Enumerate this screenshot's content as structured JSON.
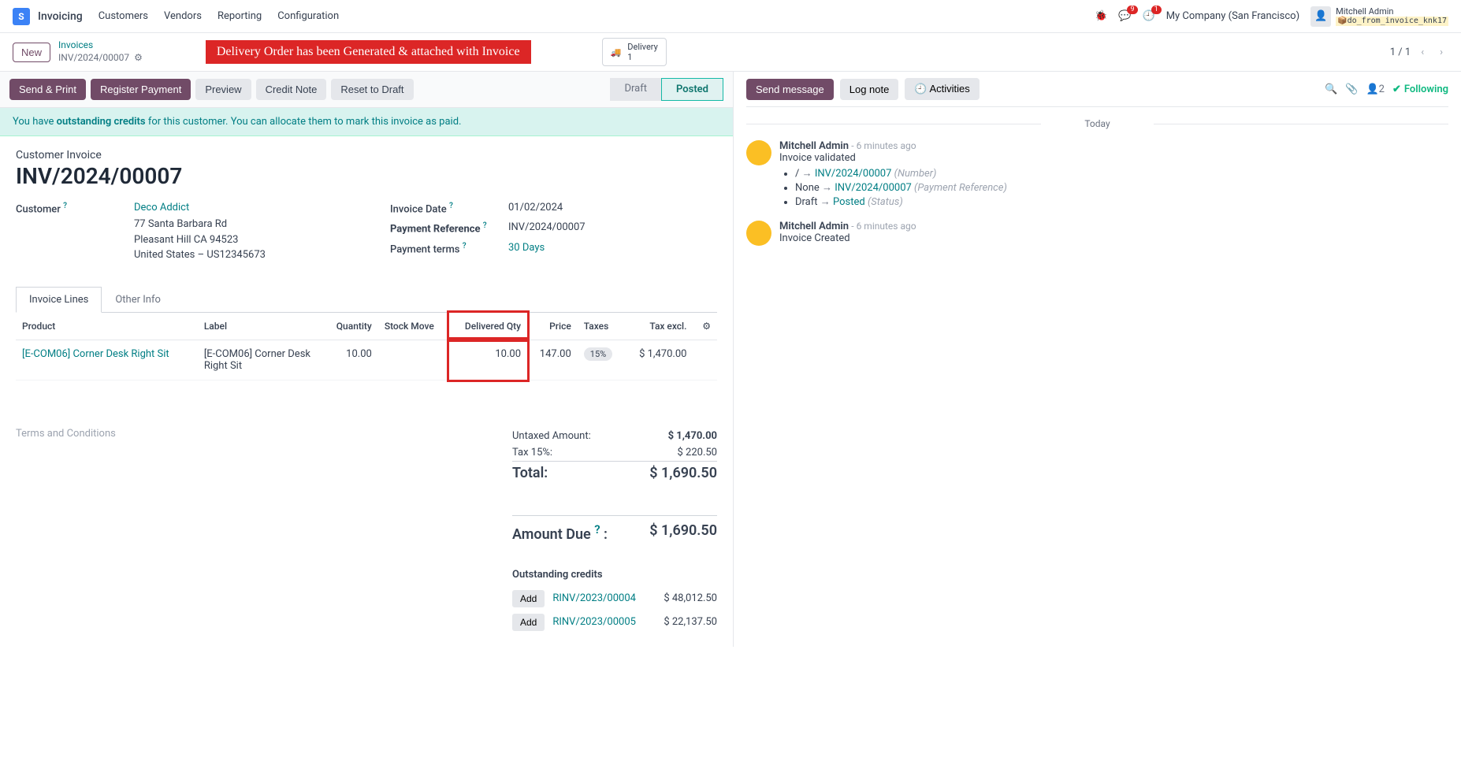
{
  "nav": {
    "app": "Invoicing",
    "menus": [
      "Customers",
      "Vendors",
      "Reporting",
      "Configuration"
    ],
    "company": "My Company (San Francisco)",
    "user": "Mitchell Admin",
    "db": "do_from_invoice_knk17",
    "msg_badge": "9",
    "activity_badge": "1"
  },
  "breadcrumb": {
    "new": "New",
    "parent": "Invoices",
    "current": "INV/2024/00007"
  },
  "annotation": "Delivery Order has been Generated & attached with Invoice",
  "smartbutton": {
    "label": "Delivery",
    "count": "1"
  },
  "pager": "1 / 1",
  "buttons": {
    "send": "Send & Print",
    "register": "Register Payment",
    "preview": "Preview",
    "credit": "Credit Note",
    "reset": "Reset to Draft"
  },
  "statuses": {
    "draft": "Draft",
    "posted": "Posted"
  },
  "alert": {
    "pre": "You have ",
    "bold": "outstanding credits",
    "post": " for this customer. You can allocate them to mark this invoice as paid."
  },
  "doc": {
    "type": "Customer Invoice",
    "name": "INV/2024/00007",
    "customer_label": "Customer",
    "customer": "Deco Addict",
    "addr1": "77 Santa Barbara Rd",
    "addr2": "Pleasant Hill CA 94523",
    "addr3": "United States – US12345673",
    "invdate_label": "Invoice Date",
    "invdate": "01/02/2024",
    "payref_label": "Payment Reference",
    "payref": "INV/2024/00007",
    "terms_label": "Payment terms",
    "terms": "30 Days"
  },
  "tabs": {
    "lines": "Invoice Lines",
    "other": "Other Info"
  },
  "columns": {
    "product": "Product",
    "label": "Label",
    "qty": "Quantity",
    "stock": "Stock Move",
    "delivered": "Delivered Qty",
    "price": "Price",
    "taxes": "Taxes",
    "taxexcl": "Tax excl."
  },
  "line": {
    "product": "[E-COM06] Corner Desk Right Sit",
    "label": "[E-COM06] Corner Desk Right Sit",
    "qty": "10.00",
    "stock": "",
    "delivered": "10.00",
    "price": "147.00",
    "tax": "15%",
    "taxexcl": "$ 1,470.00"
  },
  "termsplaceholder": "Terms and Conditions",
  "totals": {
    "untaxed_l": "Untaxed Amount:",
    "untaxed_v": "$ 1,470.00",
    "tax_l": "Tax 15%:",
    "tax_v": "$ 220.50",
    "total_l": "Total:",
    "total_v": "$ 1,690.50",
    "due_l": "Amount Due",
    "due_v": "$ 1,690.50"
  },
  "outstanding": {
    "title": "Outstanding credits",
    "add": "Add",
    "rows": [
      {
        "ref": "RINV/2023/00004",
        "amt": "$ 48,012.50"
      },
      {
        "ref": "RINV/2023/00005",
        "amt": "$ 22,137.50"
      }
    ]
  },
  "chatter": {
    "send": "Send message",
    "log": "Log note",
    "activities": "Activities",
    "followcount": "2",
    "following": "Following",
    "today": "Today",
    "msg1": {
      "author": "Mitchell Admin",
      "time": "- 6 minutes ago",
      "title": "Invoice validated",
      "li1_a": "/",
      "li1_b": "INV/2024/00007",
      "li1_c": "(Number)",
      "li2_a": "None",
      "li2_b": "INV/2024/00007",
      "li2_c": "(Payment Reference)",
      "li3_a": "Draft",
      "li3_b": "Posted",
      "li3_c": "(Status)"
    },
    "msg2": {
      "author": "Mitchell Admin",
      "time": "- 6 minutes ago",
      "title": "Invoice Created"
    }
  }
}
